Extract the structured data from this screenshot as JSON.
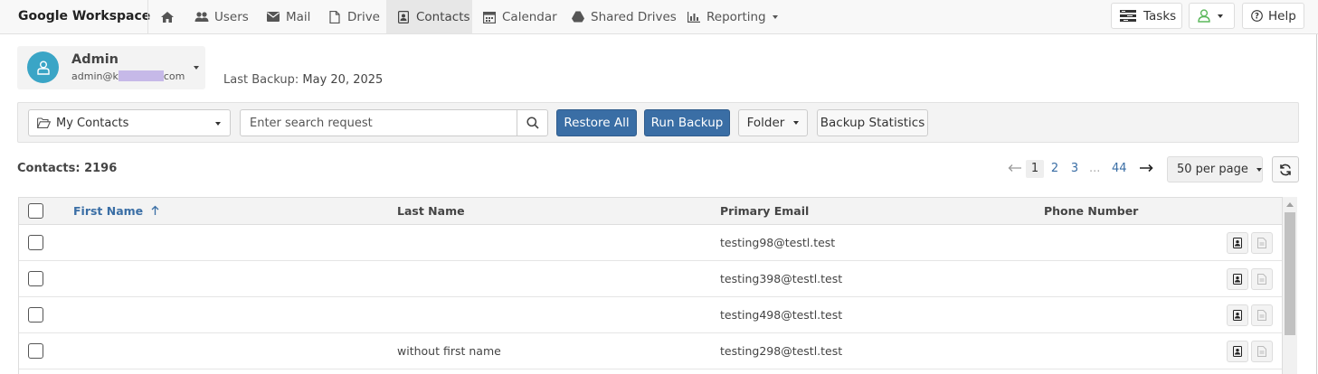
{
  "brand": "Google Workspace",
  "nav": {
    "home_icon": "home-icon",
    "items": [
      {
        "label": "Users",
        "icon": "users-icon"
      },
      {
        "label": "Mail",
        "icon": "mail-icon"
      },
      {
        "label": "Drive",
        "icon": "file-icon"
      },
      {
        "label": "Contacts",
        "icon": "contact-card-icon",
        "active": true
      },
      {
        "label": "Calendar",
        "icon": "calendar-icon"
      },
      {
        "label": "Shared Drives",
        "icon": "drive-icon"
      },
      {
        "label": "Reporting",
        "icon": "bar-chart-icon"
      }
    ],
    "tasks_label": "Tasks",
    "help_label": "Help"
  },
  "account": {
    "name": "Admin",
    "email_prefix": "admin@k",
    "email_suffix": "com"
  },
  "last_backup": {
    "label": "Last Backup:",
    "value": "May 20, 2025"
  },
  "toolbar": {
    "folder": "My Contacts",
    "search_placeholder": "Enter search request",
    "restore_all": "Restore All",
    "run_backup": "Run Backup",
    "folder_label": "Folder",
    "backup_statistics": "Backup Statistics"
  },
  "contacts_count": "Contacts: 2196",
  "pagination": {
    "pages": [
      "1",
      "2",
      "3"
    ],
    "ellipsis": "...",
    "last": "44",
    "current": "1",
    "per_page": "50 per page"
  },
  "table": {
    "columns": [
      "First Name",
      "Last Name",
      "Primary Email",
      "Phone Number"
    ],
    "sort_column": "First Name",
    "rows": [
      {
        "first": "",
        "last": "",
        "email": "testing98@testl.test",
        "phone": ""
      },
      {
        "first": "",
        "last": "",
        "email": "testing398@testl.test",
        "phone": ""
      },
      {
        "first": "",
        "last": "",
        "email": "testing498@testl.test",
        "phone": ""
      },
      {
        "first": "",
        "last": "without first name",
        "email": "testing298@testl.test",
        "phone": ""
      }
    ]
  },
  "colors": {
    "primary": "#3a6ea5",
    "avatar": "#3aa5c6",
    "status_green": "#5cb85c"
  }
}
